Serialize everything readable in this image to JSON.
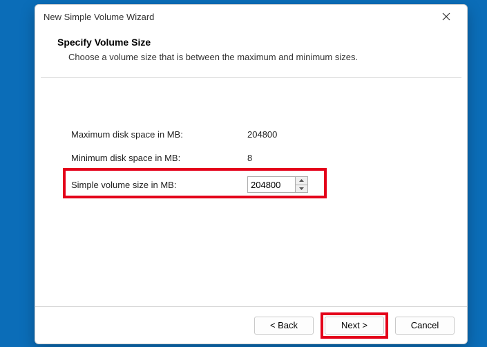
{
  "window": {
    "title": "New Simple Volume Wizard"
  },
  "header": {
    "heading": "Specify Volume Size",
    "subheading": "Choose a volume size that is between the maximum and minimum sizes."
  },
  "fields": {
    "max": {
      "label": "Maximum disk space in MB:",
      "value": "204800"
    },
    "min": {
      "label": "Minimum disk space in MB:",
      "value": "8"
    },
    "size": {
      "label": "Simple volume size in MB:",
      "value": "204800"
    }
  },
  "buttons": {
    "back": "< Back",
    "next": "Next >",
    "cancel": "Cancel"
  },
  "annotations": {
    "highlight_color": "#e4001a"
  }
}
